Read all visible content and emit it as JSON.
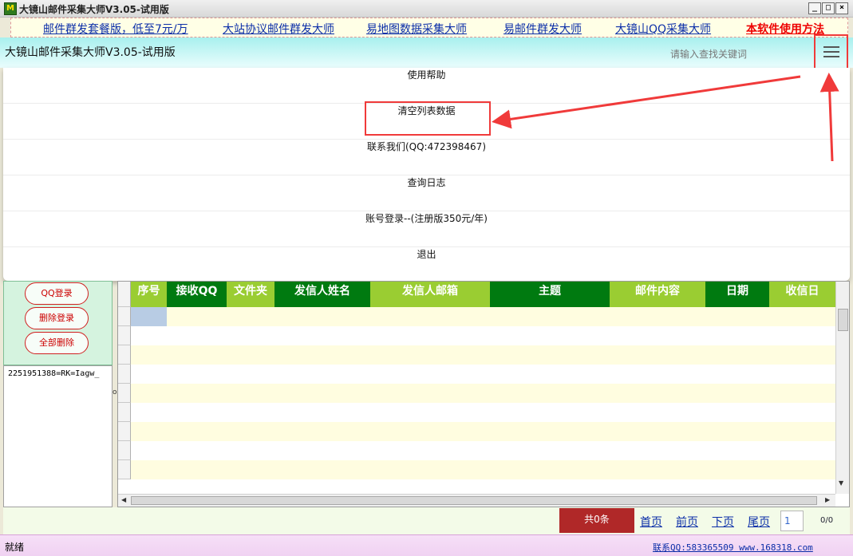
{
  "window": {
    "title": "大镜山邮件采集大师V3.05-试用版",
    "app_icon_letter": "M"
  },
  "controls": {
    "minimize": "_",
    "maximize": "□",
    "close": "×"
  },
  "links": [
    {
      "label": "邮件群发套餐版，低至7元/万"
    },
    {
      "label": "大站协议邮件群发大师"
    },
    {
      "label": "易地图数据采集大师"
    },
    {
      "label": "易邮件群发大师"
    },
    {
      "label": "大镜山QQ采集大师"
    },
    {
      "label": "本软件使用方法",
      "color": "#e00000"
    }
  ],
  "header": {
    "title": "大镜山邮件采集大师V3.05-试用版",
    "search_placeholder": "请输入查找关键词",
    "menu_icon": "hamburger-icon"
  },
  "menu": {
    "items": [
      {
        "label": "使用帮助"
      },
      {
        "label": "清空列表数据",
        "highlighted": true
      },
      {
        "label": "联系我们(QQ:472398467)"
      },
      {
        "label": "查询日志"
      },
      {
        "label": "账号登录--(注册版350元/年)"
      },
      {
        "label": "退出"
      }
    ]
  },
  "left_panel": {
    "buttons": [
      {
        "label": "QQ登录"
      },
      {
        "label": "删除登录"
      },
      {
        "label": "全部删除"
      }
    ],
    "accounts": [
      "2251951388=RK=Iagw_"
    ]
  },
  "grid": {
    "columns": [
      {
        "label": "序号",
        "color": "#9acd32"
      },
      {
        "label": "接收QQ",
        "color": "#007a10"
      },
      {
        "label": "文件夹",
        "color": "#9acd32"
      },
      {
        "label": "发信人姓名",
        "color": "#007a10"
      },
      {
        "label": "发信人邮箱",
        "color": "#9acd32"
      },
      {
        "label": "主题",
        "color": "#007a10"
      },
      {
        "label": "邮件内容",
        "color": "#9acd32"
      },
      {
        "label": "日期",
        "color": "#007a10"
      },
      {
        "label": "收信日",
        "color": "#9acd32"
      }
    ],
    "row_colors": [
      "#fffde0",
      "#ffffff"
    ],
    "selected_cell_color": "#b8cce4"
  },
  "pager": {
    "count": "共0条",
    "first": "首页",
    "prev": "前页",
    "next": "下页",
    "last": "尾页",
    "page_value": "1",
    "page_total": "0/0"
  },
  "status": {
    "text": "就绪",
    "contact": "联系QQ:583365509 www.168318.com"
  },
  "annotation_color": "#f03a3a"
}
